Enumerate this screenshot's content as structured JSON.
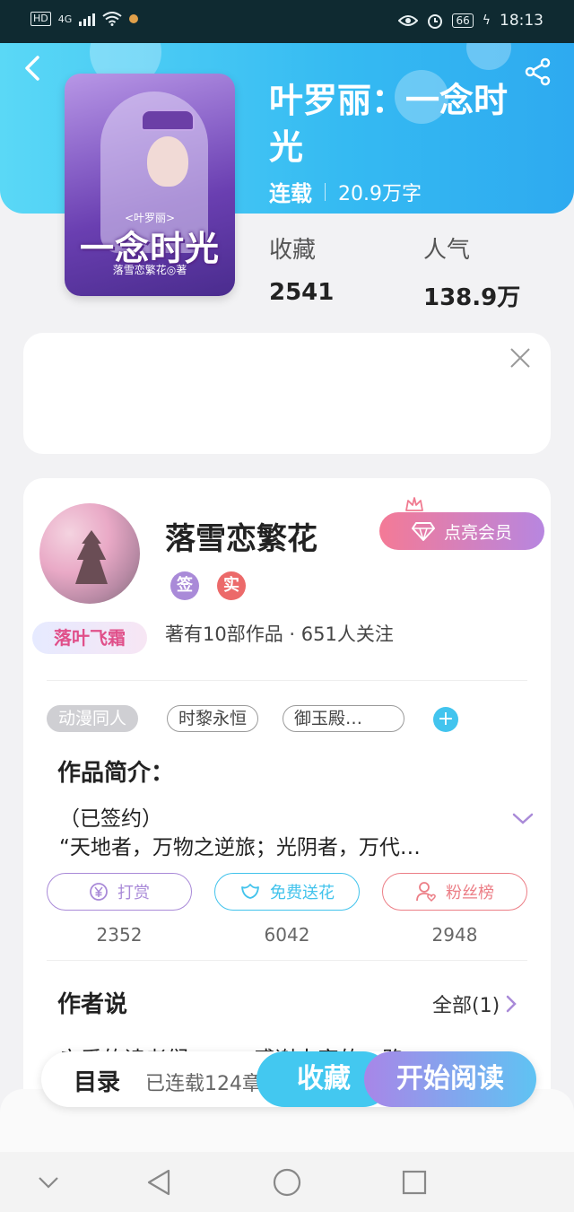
{
  "status_bar": {
    "network": "4G",
    "battery": "66",
    "time": "18:13"
  },
  "book": {
    "cover_subtitle": "<叶罗丽>",
    "cover_title": "一念时光",
    "cover_author": "落雪恋繁花◎著",
    "title": "叶罗丽：一念时光",
    "status": "连载",
    "word_count": "20.9万字",
    "favorites_label": "收藏",
    "favorites_value": "2541",
    "popularity_label": "人气",
    "popularity_value": "138.9万"
  },
  "author": {
    "name": "落雪恋繁花",
    "badge_sign": "签",
    "badge_real": "实",
    "fan_badge": "落叶飞霜",
    "stats": "著有10部作品 · 651人关注",
    "vip_label": "点亮会员"
  },
  "tags": [
    "动漫同人",
    "时黎永恒",
    "御玉殿…"
  ],
  "intro": {
    "title": "作品简介：",
    "line1": "（已签约）",
    "line2": "“天地者，万物之逆旅；光阴者，万代…"
  },
  "actions": [
    {
      "label": "打赏",
      "count": "2352",
      "color": "#a98ad8"
    },
    {
      "label": "免费送花",
      "count": "6042",
      "color": "#42c3ec"
    },
    {
      "label": "粉丝榜",
      "count": "2948",
      "color": "#ec7e86"
    }
  ],
  "author_says": {
    "title": "作者说",
    "all_link": "全部(1)",
    "peek": "亲爱的读者们，……感谢大家的一路"
  },
  "bottom_bar": {
    "toc": "目录",
    "serial": "已连载124章",
    "favorite": "收藏",
    "start_reading": "开始阅读"
  }
}
